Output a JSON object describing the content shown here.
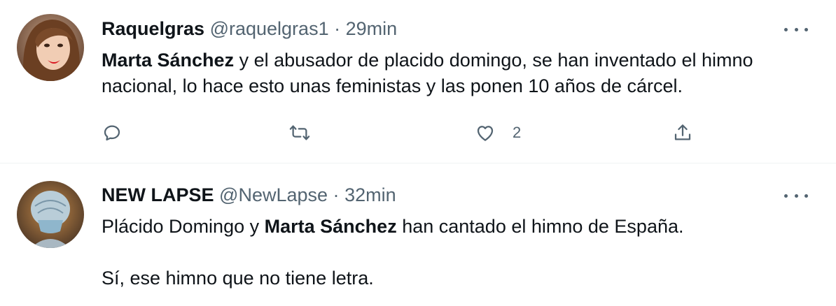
{
  "tweets": [
    {
      "name": "Raquelgras",
      "handle": "@raquelgras1",
      "separator": "·",
      "time": "29min",
      "text_bold": "Marta Sánchez",
      "text_rest_line": " y el abusador de placido domingo, se han inventado el himno nacional, lo hace esto unas feministas y las ponen 10 años de cárcel.",
      "actions": {
        "reply_icon": "reply-icon",
        "retweet_icon": "retweet-icon",
        "like_icon": "like-icon",
        "like_count": "2",
        "share_icon": "share-icon"
      },
      "more_icon": "more-icon"
    },
    {
      "name": "NEW LAPSE",
      "handle": "@NewLapse",
      "separator": "·",
      "time": "32min",
      "text_pre": "Plácido Domingo y ",
      "text_bold": "Marta Sánchez",
      "text_post": " han cantado el himno de España.",
      "text_line2": "Sí, ese himno que no tiene letra.",
      "more_icon": "more-icon"
    }
  ],
  "colors": {
    "text": "#0f1419",
    "secondary": "#536471",
    "divider": "#eff3f4",
    "lips": "#d9141e"
  }
}
